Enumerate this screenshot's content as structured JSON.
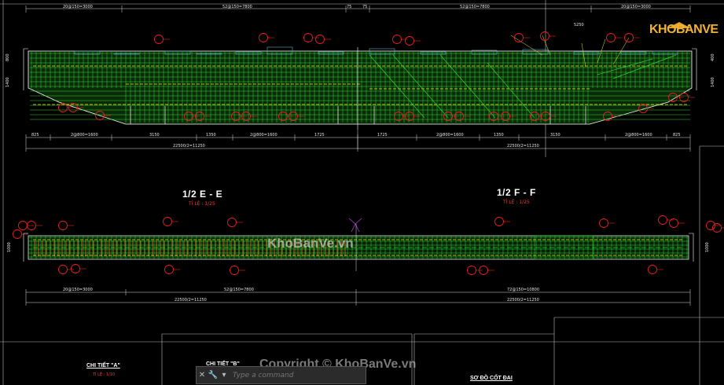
{
  "sections": {
    "e_title": "1/2 E - E",
    "e_scale": "TỈ LỆ : 1/25",
    "f_title": "1/2 F - F",
    "f_scale": "TỈ LỆ : 1/25"
  },
  "details": {
    "a_title": "CHI TIẾT \"A\"",
    "a_scale": "TỈ LỆ : 1/10",
    "b_title": "CHI TIẾT \"B\"",
    "sodo": "SƠ ĐỒ CỐT ĐAI"
  },
  "dimensions": {
    "top_left_a": "20@150=3000",
    "top_left_b": "52@150=7800",
    "top_right_a": "52@150=7800",
    "top_right_b": "20@150=3000",
    "top_mid_l": "75",
    "top_mid_r": "75",
    "right_5250": "5250",
    "mid_left": [
      "825",
      "2@800=1600",
      "3150",
      "1350",
      "2@800=1600",
      "1725"
    ],
    "mid_right": [
      "1725",
      "2@800=1600",
      "1350",
      "3150",
      "2@800=1600",
      "825"
    ],
    "mid_total_l": "22500/2=11250",
    "mid_total_r": "22500/2=11250",
    "bot_left_a": "20@150=3000",
    "bot_left_b": "52@150=7800",
    "bot_right_a": "72@150=10800",
    "bot_total_l": "22500/2=11250",
    "bot_total_r": "22500/2=11250",
    "side_l1": "800",
    "side_l2": "1400",
    "side_r1": "400",
    "side_r2": "1400",
    "bot_side_l": "1000",
    "bot_side_r": "1000"
  },
  "watermarks": {
    "center": "KhoBanVe.vn",
    "copyright": "Copyright © KhoBanVe.vn"
  },
  "logo": {
    "text": "KHOBANVE"
  },
  "command": {
    "placeholder": "Type a command",
    "close_icon": "close-icon",
    "wrench_icon": "wrench-icon",
    "recent_icon": "recent-commands-icon"
  },
  "colors": {
    "background": "#000000",
    "rebar": "#2dd82d",
    "callout": "#e82020",
    "dimension": "#e8e8e8",
    "outline": "#ffffff",
    "dashed": "#f0f020",
    "orange": "#d86a20",
    "magenta": "#b040d0"
  }
}
